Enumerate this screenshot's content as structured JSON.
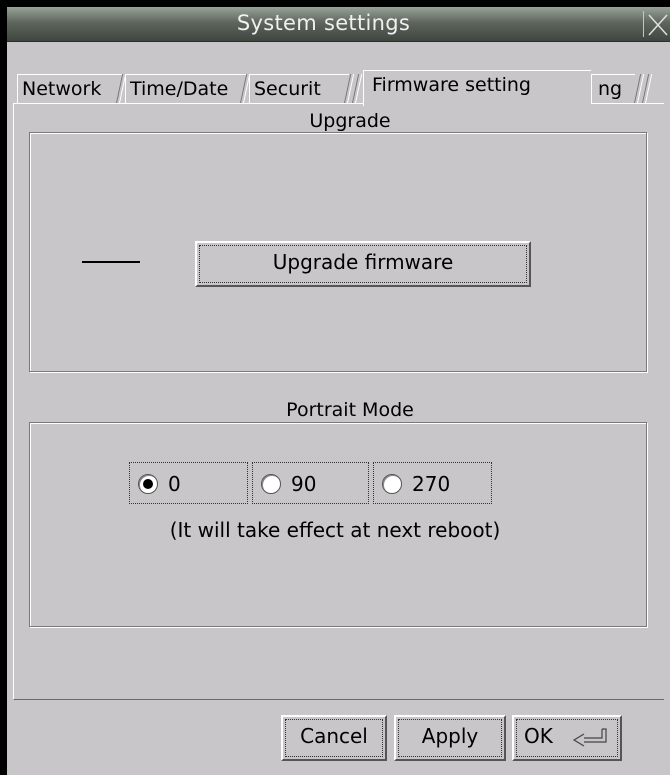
{
  "window": {
    "title": "System settings"
  },
  "tabs": [
    {
      "label": "Network"
    },
    {
      "label": "Time/Date"
    },
    {
      "label": "Securit"
    },
    {
      "label": "Firmware setting"
    },
    {
      "label": "ng"
    }
  ],
  "upgrade": {
    "group_title": "Upgrade",
    "status_text": "——",
    "button_label": "Upgrade firmware"
  },
  "portrait": {
    "group_title": "Portrait Mode",
    "options": [
      {
        "label": "0",
        "selected": true
      },
      {
        "label": "90",
        "selected": false
      },
      {
        "label": "270",
        "selected": false
      }
    ],
    "note": "(It will take effect at next reboot)"
  },
  "footer": {
    "cancel_label": "Cancel",
    "apply_label": "Apply",
    "ok_label": "OK"
  },
  "icons": {
    "close": "close-icon",
    "enter": "enter-icon"
  }
}
